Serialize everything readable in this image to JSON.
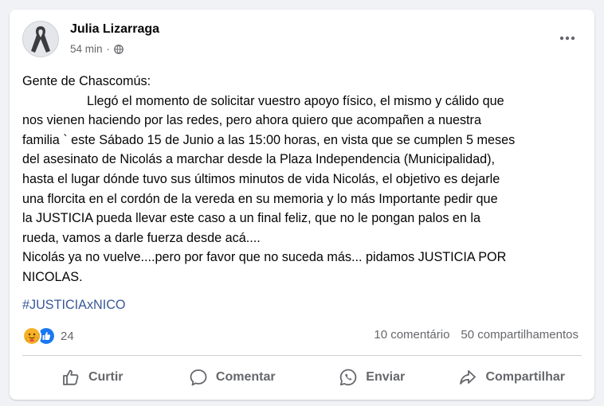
{
  "post": {
    "author": "Julia Lizarraga",
    "time": "54 min",
    "separator": "·",
    "body_lines": [
      "Gente de Chascomús:",
      "                  Llegó el momento de solicitar vuestro apoyo físico, el mismo y cálido que",
      "nos vienen haciendo por las redes, pero ahora quiero que acompañen a nuestra",
      "familia ` este Sábado 15 de Junio a las 15:00 horas, en vista que se cumplen 5 meses",
      "del asesinato de Nicolás a marchar desde la Plaza Independencia (Municipalidad),",
      "hasta el lugar dónde tuvo sus últimos minutos de vida Nicolás, el objetivo es dejarle",
      "una florcita en el cordón de la vereda en su memoria y lo más Importante pedir que",
      "la JUSTICIA pueda llevar este caso a un final feliz, que no le pongan palos en la",
      "rueda, vamos a darle fuerza desde acá....",
      "Nicolás ya no vuelve....pero por favor que no suceda más... pidamos JUSTICIA POR",
      "NICOLAS."
    ],
    "hashtag": "#JUSTICIAxNICO"
  },
  "stats": {
    "reaction_count": "24",
    "comments": "10 comentário",
    "shares": "50 compartilhamentos"
  },
  "actions": {
    "like": "Curtir",
    "comment": "Comentar",
    "send": "Enviar",
    "share": "Compartilhar"
  },
  "icons": {
    "avatar": "mourning-ribbon",
    "privacy": "globe-icon",
    "more": "ellipsis-icon",
    "reaction_1": "care-emoji",
    "reaction_2": "like-thumb"
  },
  "colors": {
    "secondary_text": "#65676b",
    "hashtag": "#385898",
    "like_blue": "#1877f2",
    "care_yellow": "#f7b125"
  }
}
